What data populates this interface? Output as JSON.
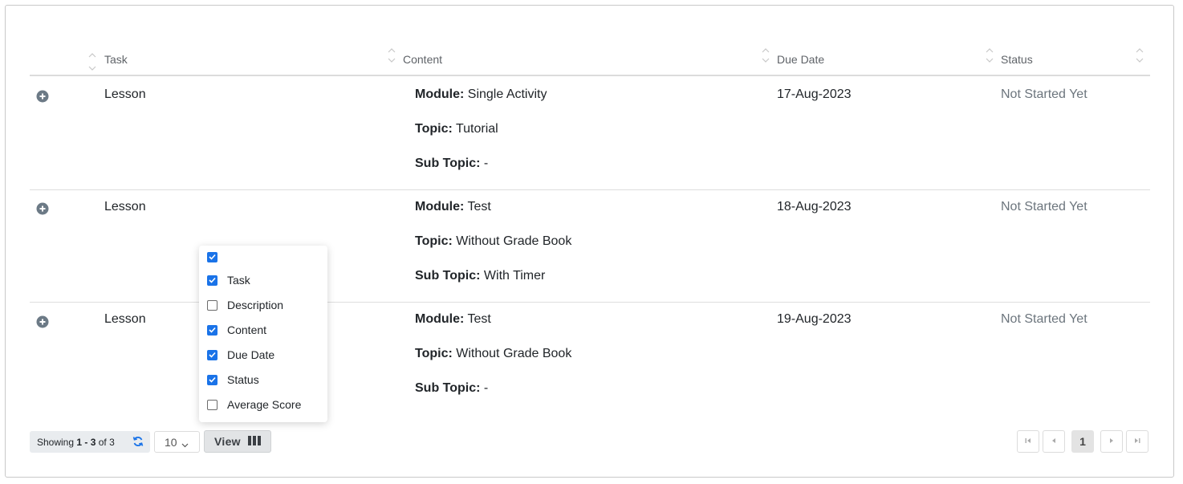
{
  "table": {
    "columns": [
      {
        "label": "Task"
      },
      {
        "label": "Content"
      },
      {
        "label": "Due Date"
      },
      {
        "label": "Status"
      }
    ],
    "rows": [
      {
        "task": "Lesson",
        "module_label": "Module:",
        "module": " Single Activity",
        "topic_label": "Topic:",
        "topic": " Tutorial",
        "subtopic_label": "Sub Topic:",
        "subtopic": " -",
        "due_date": "17-Aug-2023",
        "status": "Not Started Yet"
      },
      {
        "task": "Lesson",
        "module_label": "Module:",
        "module": " Test",
        "topic_label": "Topic:",
        "topic": " Without Grade Book",
        "subtopic_label": "Sub Topic:",
        "subtopic": " With Timer",
        "due_date": "18-Aug-2023",
        "status": "Not Started Yet"
      },
      {
        "task": "Lesson",
        "module_label": "Module:",
        "module": " Test",
        "topic_label": "Topic:",
        "topic": " Without Grade Book",
        "subtopic_label": "Sub Topic:",
        "subtopic": " -",
        "due_date": "19-Aug-2023",
        "status": "Not Started Yet"
      }
    ]
  },
  "column_menu": {
    "options": [
      {
        "label": "",
        "checked": true
      },
      {
        "label": "Task",
        "checked": true
      },
      {
        "label": "Description",
        "checked": false
      },
      {
        "label": "Content",
        "checked": true
      },
      {
        "label": "Due Date",
        "checked": true
      },
      {
        "label": "Status",
        "checked": true
      },
      {
        "label": "Average Score",
        "checked": false
      }
    ]
  },
  "footer": {
    "showing_prefix": "Showing ",
    "showing_range": "1 - 3",
    "showing_suffix": " of 3",
    "page_size": "10",
    "view_label": "View",
    "current_page": "1"
  },
  "colors": {
    "accent": "#1a73e8",
    "status_text": "#6c757d",
    "expand_icon": "#6c7a86"
  }
}
